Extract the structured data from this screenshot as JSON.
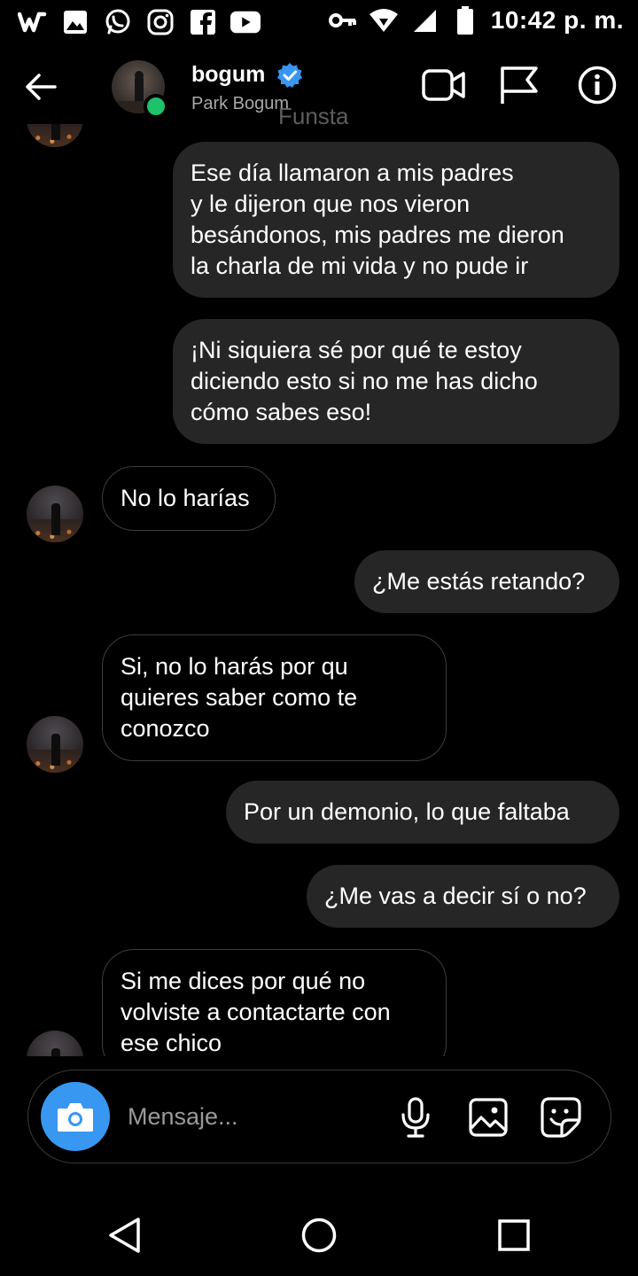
{
  "status_bar": {
    "time": "10:42 p. m.",
    "left_icons": [
      "wattpad-icon",
      "gallery-icon",
      "whatsapp-icon",
      "instagram-icon",
      "facebook-icon",
      "youtube-icon"
    ],
    "right_icons": [
      "key-icon",
      "wifi-icon",
      "signal-icon",
      "battery-icon"
    ]
  },
  "header": {
    "name": "bogum",
    "subtitle": "Park Bogum",
    "watermark": "Funsta",
    "verified": true,
    "online": true
  },
  "messages": [
    {
      "side": "out",
      "lines": [
        "Ese día llamaron a mis padres",
        "y le dijeron que nos vieron",
        "besándonos, mis padres me dieron",
        "la charla de mi vida y no pude ir"
      ]
    },
    {
      "side": "out",
      "lines": [
        "¡Ni siquiera sé por qué te estoy",
        "diciendo esto si no me has dicho",
        "cómo sabes eso!"
      ]
    },
    {
      "side": "in",
      "lines": [
        "No lo harías"
      ]
    },
    {
      "side": "out",
      "lines": [
        "¿Me estás retando?"
      ]
    },
    {
      "side": "in",
      "lines": [
        "Si, no lo harás por qu",
        "quieres saber como te",
        "conozco"
      ]
    },
    {
      "side": "out",
      "lines": [
        "Por un demonio, lo que faltaba"
      ]
    },
    {
      "side": "out",
      "lines": [
        "¿Me vas a decir sí o no?"
      ]
    },
    {
      "side": "in",
      "lines": [
        "Si me dices por qué no",
        "volviste a contactarte con",
        "ese chico"
      ]
    }
  ],
  "composer": {
    "placeholder": "Mensaje..."
  },
  "colors": {
    "accent": "#3897f0",
    "online": "#1fc16b",
    "bubble_out": "#262626",
    "verified": "#3897f0"
  }
}
